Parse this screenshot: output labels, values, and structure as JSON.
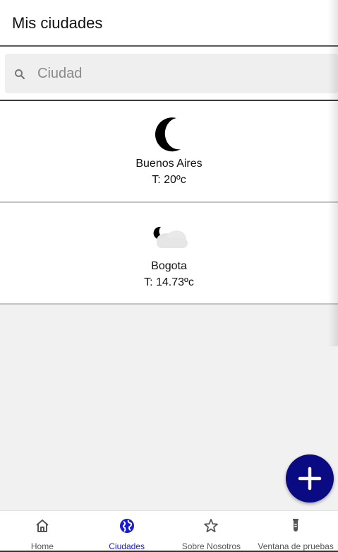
{
  "header": {
    "title": "Mis ciudades"
  },
  "search": {
    "placeholder": "Ciudad",
    "value": ""
  },
  "cities": [
    {
      "name": "Buenos Aires",
      "temp": "T: 20ºc",
      "icon": "moon-icon"
    },
    {
      "name": "Bogota",
      "temp": "T: 14.73ºc",
      "icon": "cloudy-night-icon"
    }
  ],
  "fab": {
    "icon": "plus-icon"
  },
  "nav": {
    "items": [
      {
        "label": "Home",
        "icon": "home-icon"
      },
      {
        "label": "Ciudades",
        "icon": "globe-icon",
        "active": true
      },
      {
        "label": "Sobre Nosotros",
        "icon": "star-icon"
      },
      {
        "label": "Ventana de pruebas",
        "icon": "test-tube-icon"
      }
    ]
  },
  "colors": {
    "accent": "#0a0a82",
    "active_nav": "#1a1ad0",
    "background": "#f1f1f2"
  }
}
